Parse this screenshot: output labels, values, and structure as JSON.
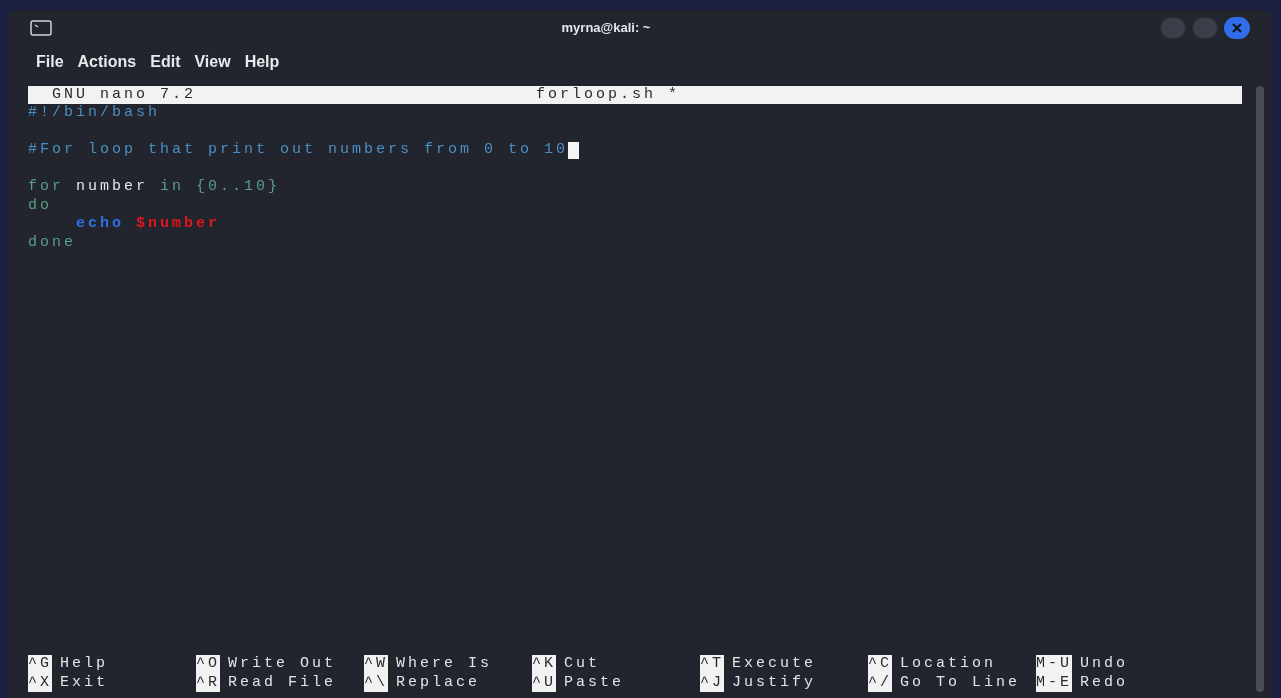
{
  "window": {
    "title": "myrna@kali: ~"
  },
  "menu": [
    "File",
    "Actions",
    "Edit",
    "View",
    "Help"
  ],
  "nano_header": {
    "version": "GNU nano 7.2",
    "filename": "forloop.sh *"
  },
  "editor": {
    "lines": [
      {
        "cursor": false,
        "tokens": [
          {
            "kind": "comment",
            "text": "#!/bin/bash"
          }
        ]
      },
      {
        "cursor": false
      },
      {
        "cursor": true,
        "tokens": [
          {
            "kind": "comment",
            "text": "#For loop that print out numbers from 0 to 10"
          }
        ]
      },
      {
        "cursor": false
      },
      {
        "cursor": false,
        "tokens": [
          {
            "kind": "keyword",
            "text": "for"
          },
          {
            "kind": "plain",
            "text": " number"
          },
          {
            "kind": "keyword",
            "text": " in"
          },
          {
            "kind": "keyword",
            "text": " {0..10}"
          }
        ]
      },
      {
        "cursor": false,
        "tokens": [
          {
            "kind": "keyword",
            "text": "do"
          }
        ]
      },
      {
        "cursor": false,
        "tokens": [
          {
            "kind": "builtin",
            "text": "    echo"
          },
          {
            "kind": "variable",
            "text": " $number"
          }
        ]
      },
      {
        "cursor": false,
        "tokens": [
          {
            "kind": "keyword",
            "text": "done"
          }
        ]
      }
    ]
  },
  "shortcuts": [
    [
      {
        "key": "^G",
        "label": "Help"
      },
      {
        "key": "^X",
        "label": "Exit"
      }
    ],
    [
      {
        "key": "^O",
        "label": "Write Out"
      },
      {
        "key": "^R",
        "label": "Read File"
      }
    ],
    [
      {
        "key": "^W",
        "label": "Where Is"
      },
      {
        "key": "^\\",
        "label": "Replace"
      }
    ],
    [
      {
        "key": "^K",
        "label": "Cut"
      },
      {
        "key": "^U",
        "label": "Paste"
      }
    ],
    [
      {
        "key": "^T",
        "label": "Execute"
      },
      {
        "key": "^J",
        "label": "Justify"
      }
    ],
    [
      {
        "key": "^C",
        "label": "Location"
      },
      {
        "key": "^/",
        "label": "Go To Line"
      }
    ],
    [
      {
        "key": "M-U",
        "label": "Undo"
      },
      {
        "key": "M-E",
        "label": "Redo"
      }
    ]
  ]
}
